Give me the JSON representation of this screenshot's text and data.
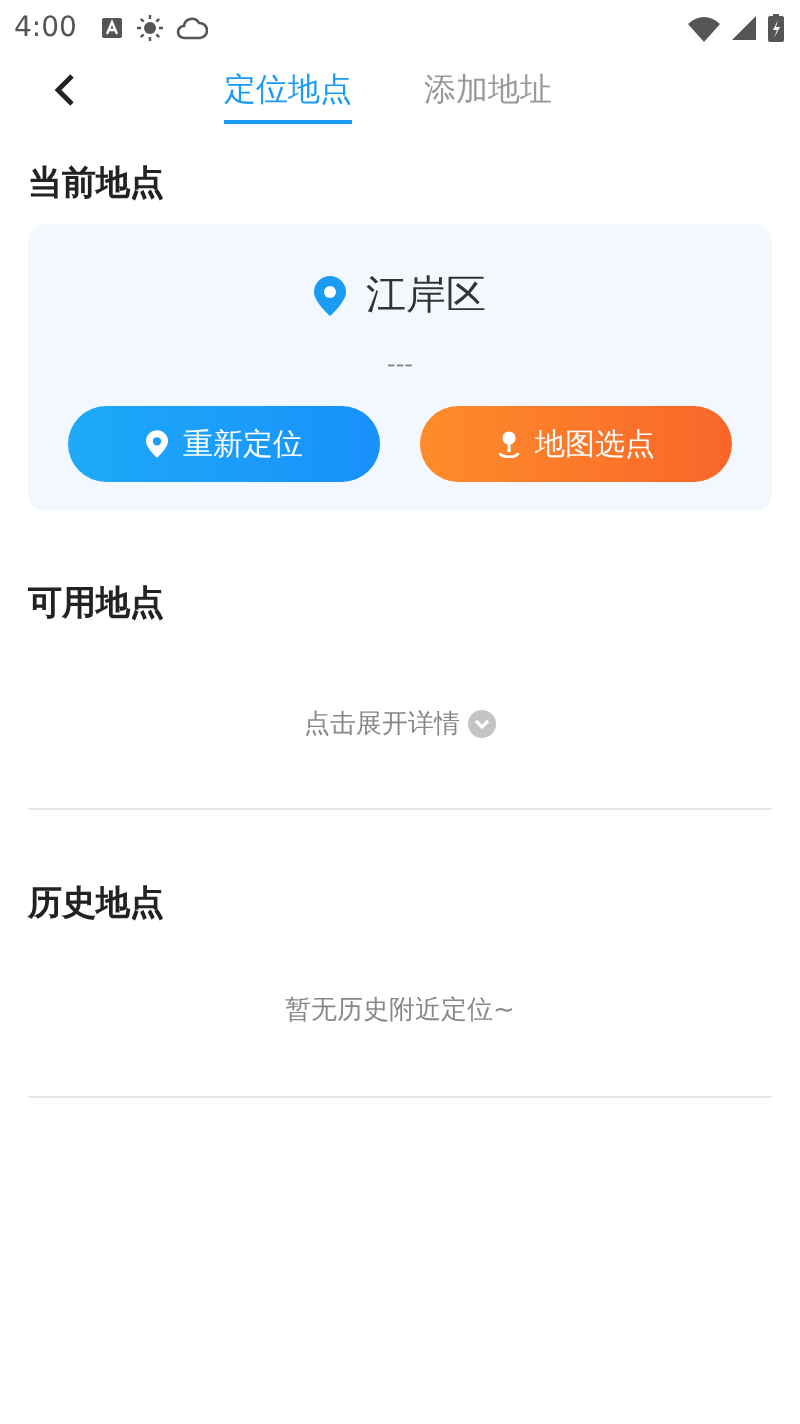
{
  "status_bar": {
    "time": "4:00"
  },
  "tabs": [
    {
      "label": "定位地点",
      "selected": true
    },
    {
      "label": "添加地址",
      "selected": false
    }
  ],
  "current": {
    "title": "当前地点",
    "place": "江岸区",
    "detail": "---",
    "buttons": [
      {
        "label": "重新定位",
        "kind": "relocate"
      },
      {
        "label": "地图选点",
        "kind": "map"
      }
    ]
  },
  "available": {
    "title": "可用地点",
    "expand": "点击展开详情",
    "expanded": false
  },
  "history": {
    "title": "历史地点",
    "empty": "暂无历史附近定位~"
  }
}
